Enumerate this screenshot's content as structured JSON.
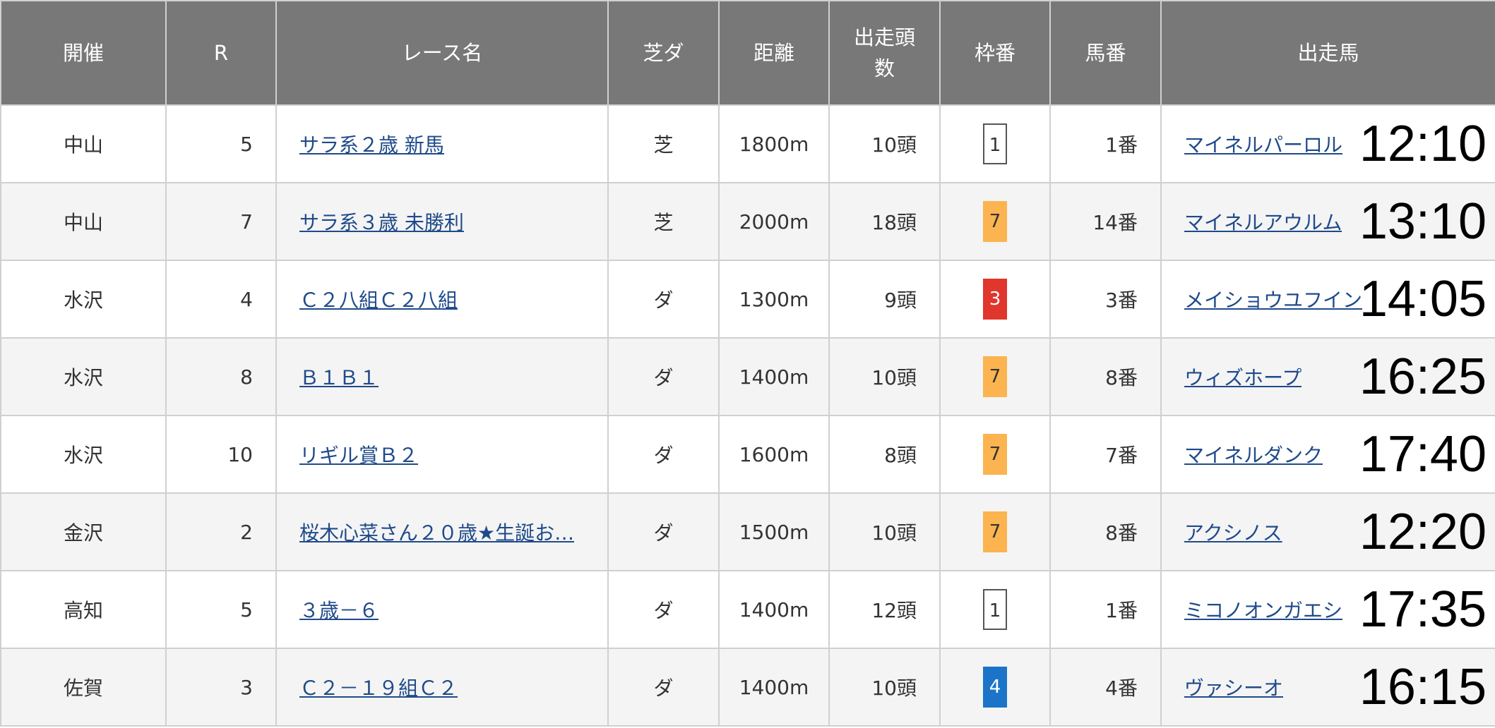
{
  "headers": [
    "開催",
    "R",
    "レース名",
    "芝ダ",
    "距離",
    "出走頭数",
    "枠番",
    "馬番",
    "出走馬"
  ],
  "waku_colors": {
    "1": "#ffffff",
    "3": "#e0362c",
    "4": "#1b74c8",
    "7": "#fbb44f"
  },
  "rows": [
    {
      "venue": "中山",
      "r": "5",
      "race": "サラ系２歳 新馬",
      "surface": "芝",
      "distance": "1800m",
      "runners": "10頭",
      "waku": "1",
      "umaban": "1番",
      "horse": "マイネルパーロル",
      "time": "12:10"
    },
    {
      "venue": "中山",
      "r": "7",
      "race": "サラ系３歳 未勝利",
      "surface": "芝",
      "distance": "2000m",
      "runners": "18頭",
      "waku": "7",
      "umaban": "14番",
      "horse": "マイネルアウルム",
      "time": "13:10"
    },
    {
      "venue": "水沢",
      "r": "4",
      "race": "Ｃ２八組Ｃ２八組",
      "surface": "ダ",
      "distance": "1300m",
      "runners": "9頭",
      "waku": "3",
      "umaban": "3番",
      "horse": "メイショウユフイン",
      "time": "14:05"
    },
    {
      "venue": "水沢",
      "r": "8",
      "race": "Ｂ１Ｂ１",
      "surface": "ダ",
      "distance": "1400m",
      "runners": "10頭",
      "waku": "7",
      "umaban": "8番",
      "horse": "ウィズホープ",
      "time": "16:25"
    },
    {
      "venue": "水沢",
      "r": "10",
      "race": "リギル賞Ｂ２",
      "surface": "ダ",
      "distance": "1600m",
      "runners": "8頭",
      "waku": "7",
      "umaban": "7番",
      "horse": "マイネルダンク",
      "time": "17:40"
    },
    {
      "venue": "金沢",
      "r": "2",
      "race": "桜木心菜さん２０歳★生誕お…",
      "surface": "ダ",
      "distance": "1500m",
      "runners": "10頭",
      "waku": "7",
      "umaban": "8番",
      "horse": "アクシノス",
      "time": "12:20"
    },
    {
      "venue": "高知",
      "r": "5",
      "race": "３歳－６",
      "surface": "ダ",
      "distance": "1400m",
      "runners": "12頭",
      "waku": "1",
      "umaban": "1番",
      "horse": "ミコノオンガエシ",
      "time": "17:35"
    },
    {
      "venue": "佐賀",
      "r": "3",
      "race": "Ｃ２－１９組Ｃ２",
      "surface": "ダ",
      "distance": "1400m",
      "runners": "10頭",
      "waku": "4",
      "umaban": "4番",
      "horse": "ヴァシーオ",
      "time": "16:15"
    }
  ]
}
